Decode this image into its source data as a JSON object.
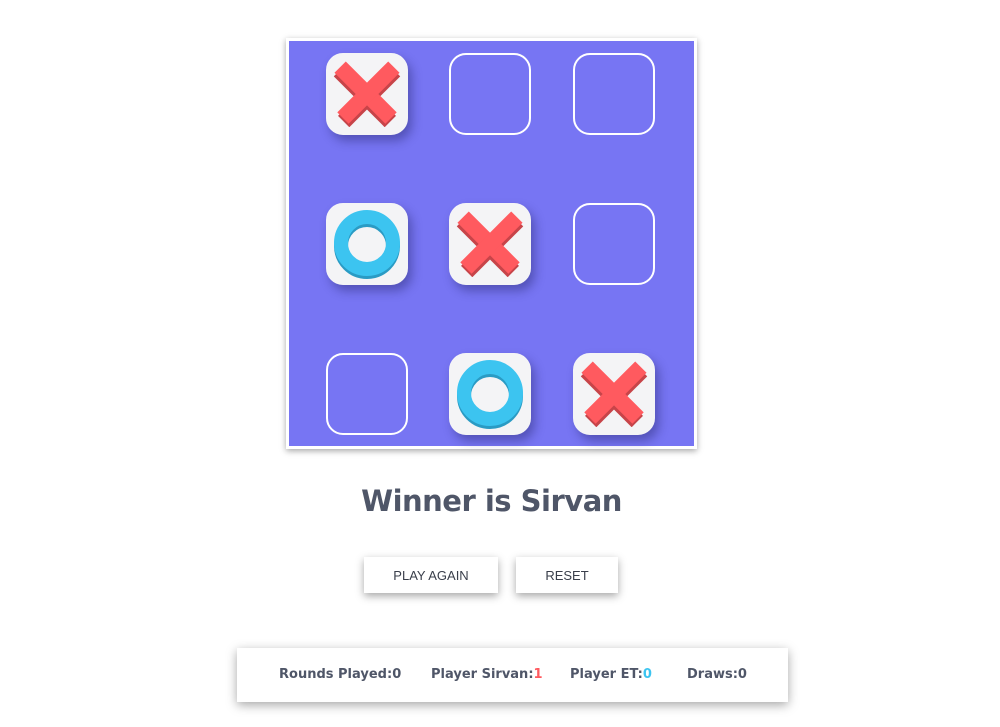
{
  "board": {
    "cells": [
      "X",
      "",
      "",
      "O",
      "X",
      "",
      "",
      "O",
      "X"
    ]
  },
  "status": {
    "winner_text": "Winner is Sirvan"
  },
  "buttons": {
    "play_again": "PLAY AGAIN",
    "reset": "RESET"
  },
  "scoreboard": {
    "rounds_label": "Rounds Played:",
    "rounds_value": "0",
    "player1_label": "Player Sirvan:",
    "player1_value": "1",
    "player2_label": "Player ET:",
    "player2_value": "0",
    "draws_label": "Draws:",
    "draws_value": "0"
  },
  "colors": {
    "board_bg": "#7775f3",
    "x_mark": "#ff5a5f",
    "o_mark": "#3cc4f0",
    "text": "#4f5668"
  },
  "icons": {
    "x": "x-mark-icon",
    "o": "o-mark-icon"
  }
}
